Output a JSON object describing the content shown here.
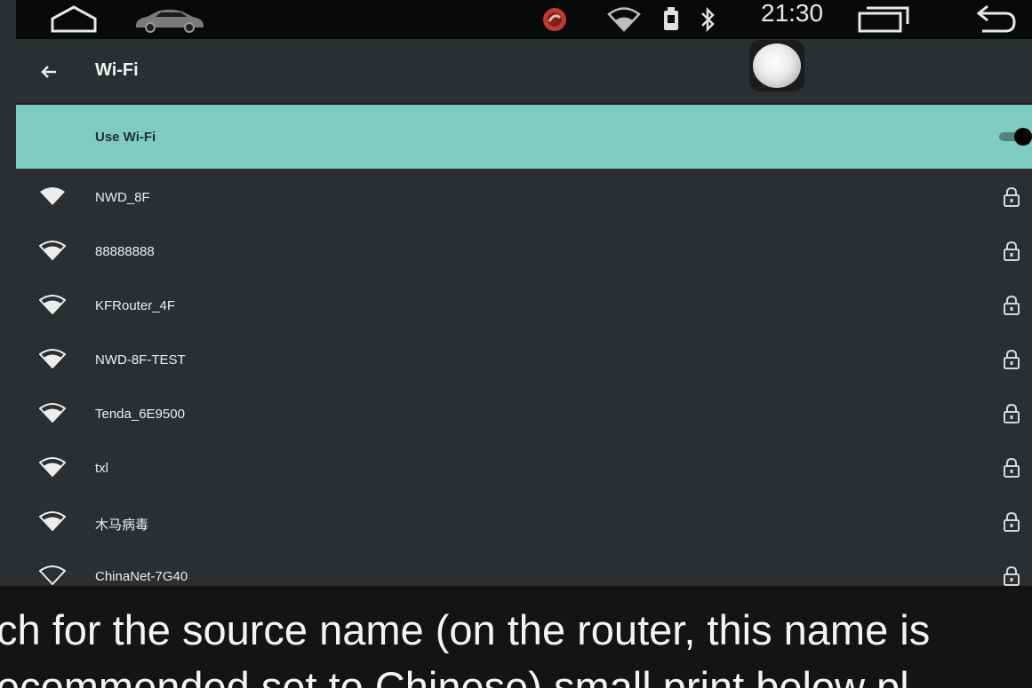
{
  "status_bar": {
    "time": "21:30",
    "icons": [
      "home-icon",
      "car-icon",
      "notification-icon",
      "wifi-signal-icon",
      "battery-icon",
      "bluetooth-icon",
      "recent-apps-icon",
      "back-icon"
    ]
  },
  "app_bar": {
    "title": "Wi-Fi",
    "back_icon": "arrow-left-icon"
  },
  "wifi_toggle": {
    "label": "Use Wi-Fi",
    "enabled": true,
    "highlight_color": "#7fcbc4"
  },
  "networks": [
    {
      "ssid": "NWD_8F",
      "secured": true
    },
    {
      "ssid": "88888888",
      "secured": true
    },
    {
      "ssid": "KFRouter_4F",
      "secured": true
    },
    {
      "ssid": "NWD-8F-TEST",
      "secured": true
    },
    {
      "ssid": "Tenda_6E9500",
      "secured": true
    },
    {
      "ssid": "txl",
      "secured": true
    },
    {
      "ssid": "木马病毒",
      "secured": true
    },
    {
      "ssid": "ChinaNet-7G40",
      "secured": true
    }
  ],
  "caption": {
    "line1": "ch for the source name (on the router, this name is",
    "line2": "ecommended set to Chinese) small print below pl"
  }
}
